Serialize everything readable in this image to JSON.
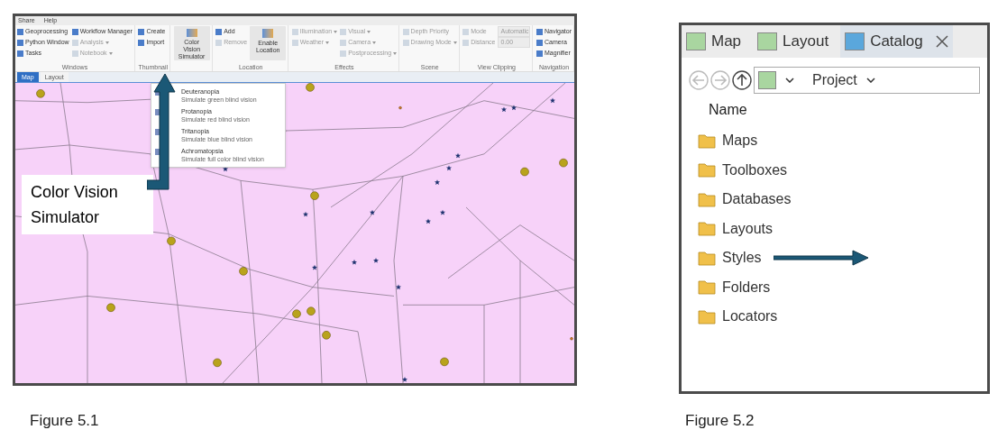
{
  "left_figure": {
    "menu": [
      "Share",
      "Help"
    ],
    "ribbon_groups": [
      {
        "label": "Windows",
        "columns": [
          [
            {
              "text": "Geoprocessing",
              "kind": "small",
              "disabled": false
            },
            {
              "text": "Python Window",
              "kind": "small",
              "disabled": false
            },
            {
              "text": "Tasks",
              "kind": "small",
              "disabled": false
            }
          ],
          [
            {
              "text": "Workflow Manager",
              "kind": "small",
              "disabled": false
            },
            {
              "text": "Analysis",
              "kind": "dropdown",
              "disabled": true
            },
            {
              "text": "Notebook",
              "kind": "dropdown",
              "disabled": true
            }
          ]
        ]
      },
      {
        "label": "Thumbnail",
        "columns": [
          [
            {
              "text": "Create",
              "kind": "small",
              "disabled": false
            },
            {
              "text": "Import",
              "kind": "small",
              "disabled": false
            }
          ]
        ]
      },
      {
        "columns": [
          [
            {
              "text": "Color Vision Simulator",
              "kind": "large",
              "disabled": false
            }
          ]
        ]
      },
      {
        "label": "Location",
        "columns": [
          [
            {
              "text": "Add",
              "kind": "small",
              "disabled": false
            },
            {
              "text": "Remove",
              "kind": "small",
              "disabled": true
            }
          ],
          [
            {
              "text": "Enable Location",
              "kind": "large",
              "disabled": false
            }
          ]
        ]
      },
      {
        "label": "Effects",
        "columns": [
          [
            {
              "text": "Illumination",
              "kind": "dropdown",
              "disabled": true
            },
            {
              "text": "Weather",
              "kind": "dropdown",
              "disabled": true
            }
          ],
          [
            {
              "text": "Visual",
              "kind": "dropdown",
              "disabled": true
            },
            {
              "text": "Camera",
              "kind": "dropdown",
              "disabled": true
            },
            {
              "text": "Postprocessing",
              "kind": "dropdown",
              "disabled": true
            }
          ]
        ]
      },
      {
        "label": "Scene",
        "columns": [
          [
            {
              "text": "Depth Priority",
              "kind": "small",
              "disabled": true
            },
            {
              "text": "Drawing Mode",
              "kind": "dropdown",
              "disabled": true
            }
          ]
        ]
      },
      {
        "label": "View Clipping",
        "columns": [
          [
            {
              "text": "Mode",
              "kind": "small",
              "disabled": true
            },
            {
              "text": "Distance",
              "kind": "small",
              "disabled": true
            }
          ],
          [
            {
              "text": "Automatic",
              "kind": "field",
              "disabled": true
            },
            {
              "text": "0.00",
              "kind": "field",
              "disabled": true
            }
          ]
        ]
      },
      {
        "label": "Navigation",
        "columns": [
          [
            {
              "text": "Navigator",
              "kind": "small",
              "disabled": false
            },
            {
              "text": "Camera",
              "kind": "small",
              "disabled": false
            },
            {
              "text": "Magnifier",
              "kind": "small",
              "disabled": false
            }
          ]
        ]
      }
    ],
    "doc_tabs": [
      {
        "label": "Map",
        "selected": true
      },
      {
        "label": "Layout",
        "selected": false
      }
    ],
    "dropdown": [
      {
        "title": "Deuteranopia",
        "subtitle": "Simulate green blind vision"
      },
      {
        "title": "Protanopia",
        "subtitle": "Simulate red blind vision"
      },
      {
        "title": "Tritanopia",
        "subtitle": "Simulate blue blind vision"
      },
      {
        "title": "Achromatopsia",
        "subtitle": "Simulate full color blind vision"
      }
    ],
    "callout": "Color Vision Simulator",
    "caption": "Figure 5.1"
  },
  "right_figure": {
    "tabs": [
      {
        "label": "Map",
        "selected": false
      },
      {
        "label": "Layout",
        "selected": false
      },
      {
        "label": "Catalog",
        "selected": true
      }
    ],
    "location": "Project",
    "column_header": "Name",
    "items": [
      "Maps",
      "Toolboxes",
      "Databases",
      "Layouts",
      "Styles",
      "Folders",
      "Locators"
    ],
    "caption": "Figure 5.2"
  }
}
